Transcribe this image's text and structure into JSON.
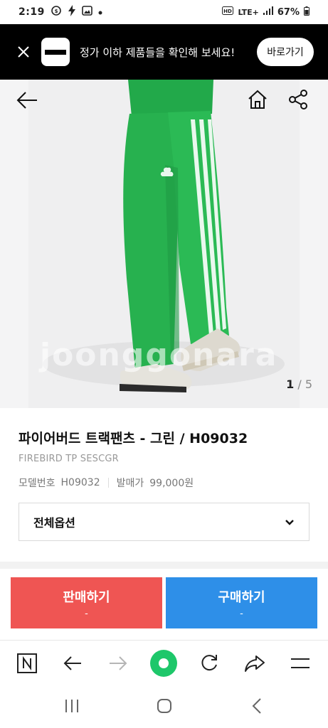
{
  "status_bar": {
    "time": "2:19",
    "network": "LTE+",
    "battery": "67%"
  },
  "banner": {
    "message": "정가 이하 제품들을 확인해 보세요!",
    "button_label": "바로가기"
  },
  "gallery": {
    "current": "1",
    "separator": " / ",
    "total": "5",
    "watermark": "joonggonara"
  },
  "product": {
    "title": "파이어버드 트랙팬츠 - 그린 / H09032",
    "subtitle": "FIREBIRD TP SESCGR",
    "model_label": "모델번호",
    "model_value": "H09032",
    "price_label": "발매가",
    "price_value": "99,000원",
    "option_label": "전체옵션"
  },
  "actions": {
    "sell_label": "판매하기",
    "sell_sub": "-",
    "buy_label": "구매하기",
    "buy_sub": "-"
  },
  "colors": {
    "sell": "#ef5553",
    "buy": "#2e8fe8",
    "banner_bg": "#000000",
    "pants_green": "#27b14f",
    "home_green": "#1ec76a"
  }
}
